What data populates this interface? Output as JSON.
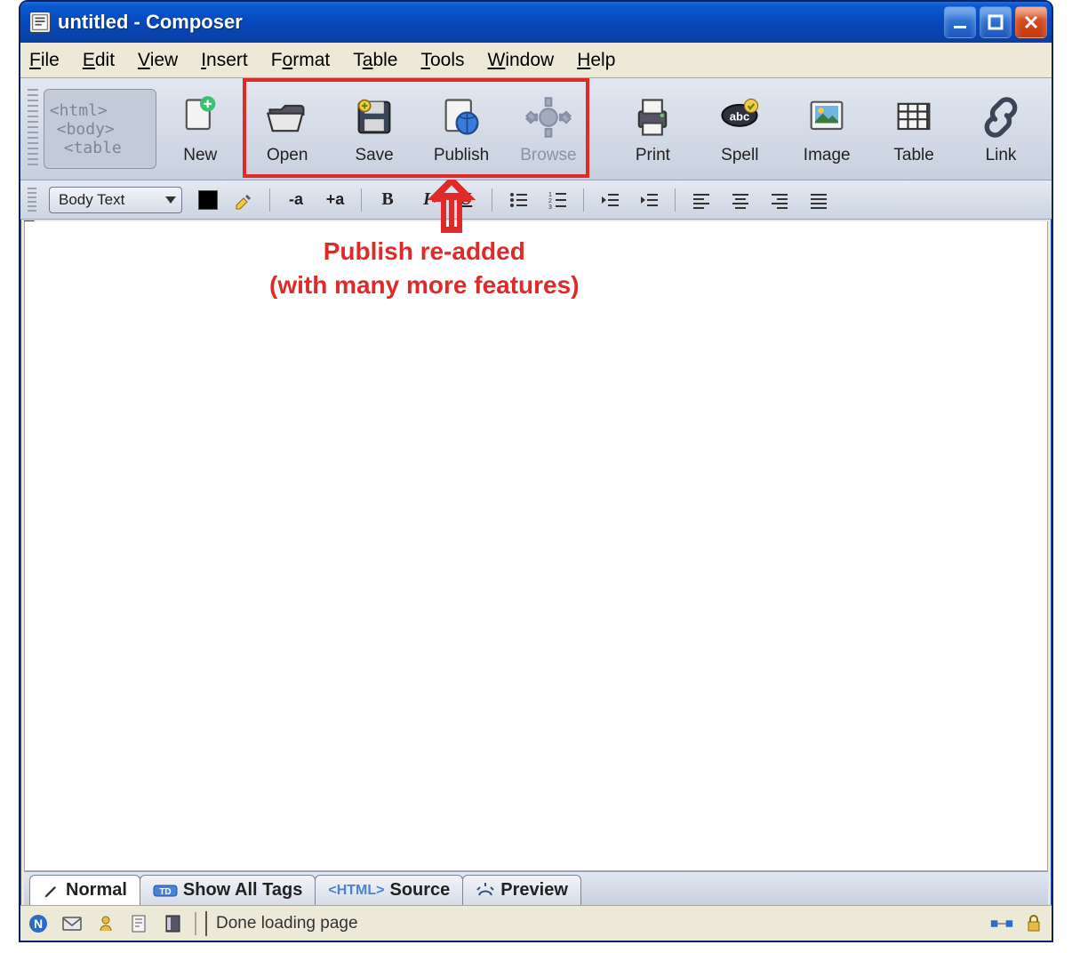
{
  "window": {
    "title": "untitled - Composer"
  },
  "menu": {
    "file": "File",
    "edit": "Edit",
    "view": "View",
    "insert": "Insert",
    "format": "Format",
    "table": "Table",
    "tools": "Tools",
    "window": "Window",
    "help": "Help"
  },
  "tags_panel": {
    "line1": "<html>",
    "line2": "<body>",
    "line3": "<table"
  },
  "toolbar": {
    "new": "New",
    "open": "Open",
    "save": "Save",
    "publish": "Publish",
    "browse": "Browse",
    "print": "Print",
    "spell": "Spell",
    "image": "Image",
    "tbl": "Table",
    "link": "Link"
  },
  "format_bar": {
    "paragraph_style": "Body Text"
  },
  "annotation": {
    "line1": "Publish re-added",
    "line2": "(with many more features)"
  },
  "view_tabs": {
    "normal": "Normal",
    "show_all_tags": "Show All Tags",
    "html_label": "HTML",
    "source": "Source",
    "preview": "Preview"
  },
  "status": {
    "text": "Done loading page"
  }
}
